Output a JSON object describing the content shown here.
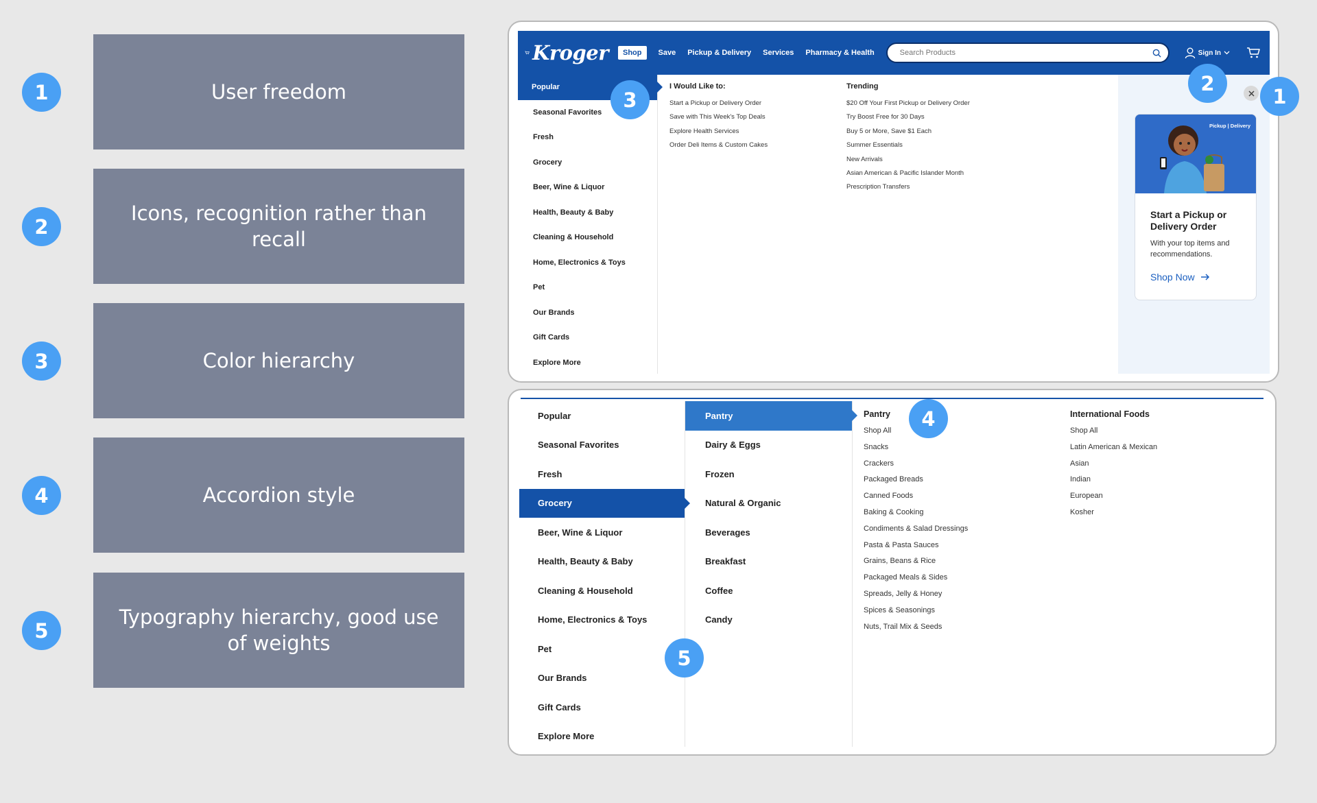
{
  "legend": [
    {
      "num": "1",
      "label": "User freedom"
    },
    {
      "num": "2",
      "label": "Icons, recognition rather than recall"
    },
    {
      "num": "3",
      "label": "Color hierarchy"
    },
    {
      "num": "4",
      "label": "Accordion style"
    },
    {
      "num": "5",
      "label": "Typography hierarchy, good use of weights"
    }
  ],
  "header": {
    "logo": "Kroger",
    "nav": [
      "Shop",
      "Save",
      "Pickup & Delivery",
      "Services",
      "Pharmacy & Health"
    ],
    "search_placeholder": "Search Products",
    "signin": "Sign In"
  },
  "top_menu": {
    "categories": [
      "Popular",
      "Seasonal Favorites",
      "Fresh",
      "Grocery",
      "Beer, Wine & Liquor",
      "Health, Beauty & Baby",
      "Cleaning & Household",
      "Home, Electronics & Toys",
      "Pet",
      "Our Brands",
      "Gift Cards",
      "Explore More"
    ],
    "would_like": {
      "title": "I Would Like to:",
      "links": [
        "Start a Pickup or Delivery Order",
        "Save with This Week's Top Deals",
        "Explore Health Services",
        "Order Deli Items & Custom Cakes"
      ]
    },
    "trending": {
      "title": "Trending",
      "links": [
        "$20 Off Your First Pickup or Delivery Order",
        "Try Boost Free for 30 Days",
        "Buy 5 or More, Save $1 Each",
        "Summer Essentials",
        "New Arrivals",
        "Asian American & Pacific Islander Month",
        "Prescription Transfers"
      ]
    },
    "promo": {
      "tag": "Pickup | Delivery",
      "title": "Start a Pickup or Delivery Order",
      "desc": "With your top items and recommendations.",
      "link": "Shop Now"
    }
  },
  "bottom_menu": {
    "categories": [
      "Popular",
      "Seasonal Favorites",
      "Fresh",
      "Grocery",
      "Beer, Wine & Liquor",
      "Health, Beauty & Baby",
      "Cleaning & Household",
      "Home, Electronics & Toys",
      "Pet",
      "Our Brands",
      "Gift Cards",
      "Explore More"
    ],
    "subcategories": [
      "Pantry",
      "Dairy & Eggs",
      "Frozen",
      "Natural & Organic",
      "Beverages",
      "Breakfast",
      "Coffee",
      "Candy"
    ],
    "pantry": {
      "title": "Pantry",
      "links": [
        "Shop All",
        "Snacks",
        "Crackers",
        "Packaged Breads",
        "Canned Foods",
        "Baking & Cooking",
        "Condiments & Salad Dressings",
        "Pasta & Pasta Sauces",
        "Grains, Beans & Rice",
        "Packaged Meals & Sides",
        "Spreads, Jelly & Honey",
        "Spices & Seasonings",
        "Nuts, Trail Mix & Seeds"
      ]
    },
    "international": {
      "title": "International Foods",
      "links": [
        "Shop All",
        "Latin American & Mexican",
        "Asian",
        "Indian",
        "European",
        "Kosher"
      ]
    }
  },
  "callouts": [
    "3",
    "2",
    "1",
    "4",
    "5"
  ],
  "colors": {
    "brand": "#1452a8",
    "badge": "#4aa0f4",
    "legend_box": "#7b8397"
  }
}
